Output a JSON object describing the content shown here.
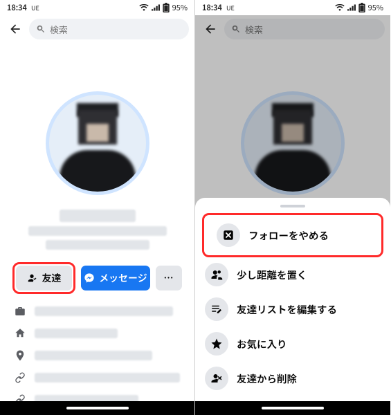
{
  "statusbar": {
    "time": "18:34",
    "carrier": "UE",
    "battery_pct": "95%"
  },
  "topbar": {
    "search_placeholder": "検索"
  },
  "actions": {
    "friends_label": "友達",
    "message_label": "メッセージ",
    "more_label": "…"
  },
  "sheet": {
    "items": [
      {
        "label": "フォローをやめる",
        "icon": "unfollow"
      },
      {
        "label": "少し距離を置く",
        "icon": "take-break"
      },
      {
        "label": "友達リストを編集する",
        "icon": "edit-list"
      },
      {
        "label": "お気に入り",
        "icon": "favorite"
      },
      {
        "label": "友達から削除",
        "icon": "unfriend"
      }
    ]
  }
}
